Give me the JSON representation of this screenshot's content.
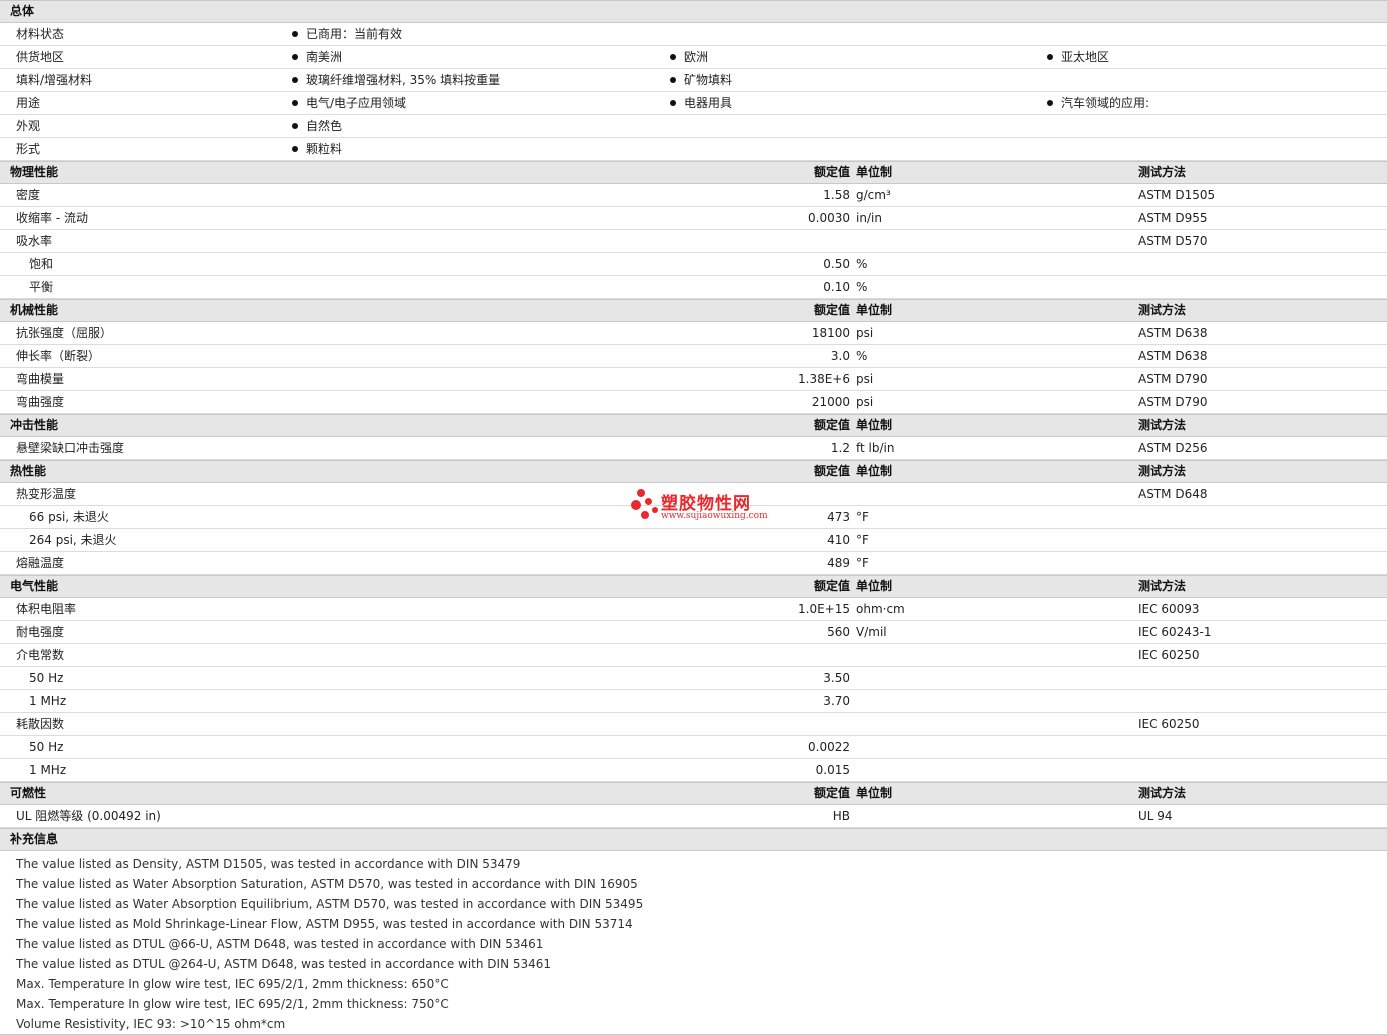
{
  "general": {
    "title": "总体",
    "rows": [
      {
        "label": "材料状态",
        "items": [
          "已商用：当前有效"
        ]
      },
      {
        "label": "供货地区",
        "items": [
          "南美洲",
          "欧洲",
          "亚太地区"
        ]
      },
      {
        "label": "填料/增强材料",
        "items": [
          "玻璃纤维增强材料, 35% 填料按重量",
          "矿物填料"
        ]
      },
      {
        "label": "用途",
        "items": [
          "电气/电子应用领域",
          "电器用具",
          "汽车领域的应用:"
        ]
      },
      {
        "label": "外观",
        "items": [
          "自然色"
        ]
      },
      {
        "label": "形式",
        "items": [
          "颗粒料"
        ]
      }
    ]
  },
  "header_labels": {
    "value": "额定值",
    "unit": "单位制",
    "test": "测试方法"
  },
  "physical": {
    "title": "物理性能",
    "rows": [
      {
        "label": "密度",
        "value": "1.58",
        "unit": "g/cm³",
        "test": "ASTM D1505"
      },
      {
        "label": "收缩率  - 流动",
        "value": "0.0030",
        "unit": "in/in",
        "test": "ASTM D955"
      },
      {
        "label": "吸水率",
        "value": "",
        "unit": "",
        "test": "ASTM D570"
      },
      {
        "label": "饱和",
        "value": "0.50",
        "unit": "%",
        "test": ""
      },
      {
        "label": "平衡",
        "value": "0.10",
        "unit": "%",
        "test": ""
      }
    ]
  },
  "mechanical": {
    "title": "机械性能",
    "rows": [
      {
        "label": "抗张强度（屈服）",
        "value": "18100",
        "unit": "psi",
        "test": "ASTM D638"
      },
      {
        "label": "伸长率（断裂）",
        "value": "3.0",
        "unit": "%",
        "test": "ASTM D638"
      },
      {
        "label": "弯曲模量",
        "value": "1.38E+6",
        "unit": "psi",
        "test": "ASTM D790"
      },
      {
        "label": "弯曲强度",
        "value": "21000",
        "unit": "psi",
        "test": "ASTM D790"
      }
    ]
  },
  "impact": {
    "title": "冲击性能",
    "rows": [
      {
        "label": "悬壁梁缺口冲击强度",
        "value": "1.2",
        "unit": "ft lb/in",
        "test": "ASTM D256"
      }
    ]
  },
  "thermal": {
    "title": "热性能",
    "rows": [
      {
        "label": "热变形温度",
        "value": "",
        "unit": "",
        "test": "ASTM D648"
      },
      {
        "label": "66 psi, 未退火",
        "value": "473",
        "unit": "°F",
        "test": ""
      },
      {
        "label": "264 psi, 未退火",
        "value": "410",
        "unit": "°F",
        "test": ""
      },
      {
        "label": "熔融温度",
        "value": "489",
        "unit": "°F",
        "test": ""
      }
    ]
  },
  "electrical": {
    "title": "电气性能",
    "rows": [
      {
        "label": "体积电阻率",
        "value": "1.0E+15",
        "unit": "ohm·cm",
        "test": "IEC 60093"
      },
      {
        "label": "耐电强度",
        "value": "560",
        "unit": "V/mil",
        "test": "IEC 60243-1"
      },
      {
        "label": "介电常数",
        "value": "",
        "unit": "",
        "test": "IEC 60250"
      },
      {
        "label": "50 Hz",
        "value": "3.50",
        "unit": "",
        "test": ""
      },
      {
        "label": "1 MHz",
        "value": "3.70",
        "unit": "",
        "test": ""
      },
      {
        "label": "耗散因数",
        "value": "",
        "unit": "",
        "test": "IEC 60250"
      },
      {
        "label": "50 Hz",
        "value": "0.0022",
        "unit": "",
        "test": ""
      },
      {
        "label": "1 MHz",
        "value": "0.015",
        "unit": "",
        "test": ""
      }
    ]
  },
  "flammability": {
    "title": "可燃性",
    "rows": [
      {
        "label": "UL 阻燃等级  (0.00492 in)",
        "value": "HB",
        "unit": "",
        "test": "UL 94"
      }
    ]
  },
  "notes": {
    "title": "补充信息",
    "items": [
      "The value listed as Density, ASTM D1505, was tested in accordance with DIN 53479",
      "The value listed as Water Absorption Saturation, ASTM D570, was tested in accordance with DIN 16905",
      "The value listed as Water Absorption Equilibrium, ASTM D570, was tested in accordance with DIN 53495",
      "The value listed as Mold Shrinkage-Linear Flow, ASTM D955, was tested in accordance with DIN 53714",
      "The value listed as DTUL @66-U, ASTM D648, was tested in accordance with DIN 53461",
      "The value listed as DTUL @264-U, ASTM D648, was tested in accordance with DIN 53461",
      "Max. Temperature In glow wire test, IEC 695/2/1, 2mm thickness: 650°C",
      "Max. Temperature In glow wire test, IEC 695/2/1, 2mm thickness: 750°C",
      "Volume Resistivity, IEC 93: >10^15 ohm*cm"
    ]
  },
  "watermark": {
    "name": "塑胶物性网",
    "url": "www.sujiaowuxing.com",
    "color": "#e8282b"
  }
}
